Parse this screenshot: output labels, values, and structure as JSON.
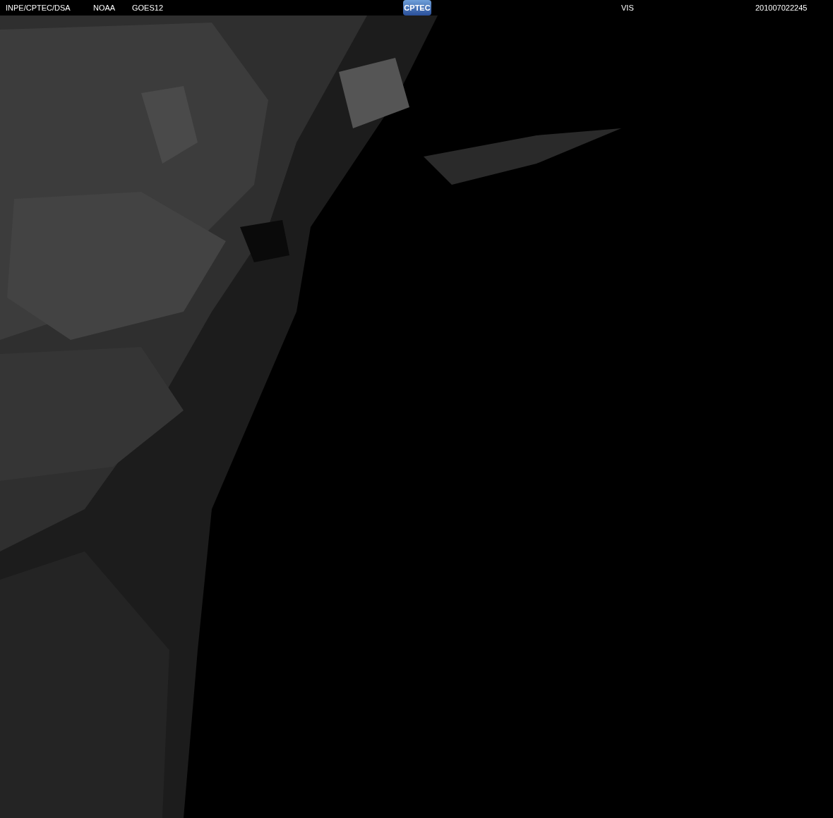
{
  "header": {
    "labels": [
      "INPE/CPTEC/DSA",
      "NOAA",
      "GOES12"
    ],
    "logo": "CPTEC",
    "channel": "VIS",
    "timestamp": "201007022245"
  }
}
